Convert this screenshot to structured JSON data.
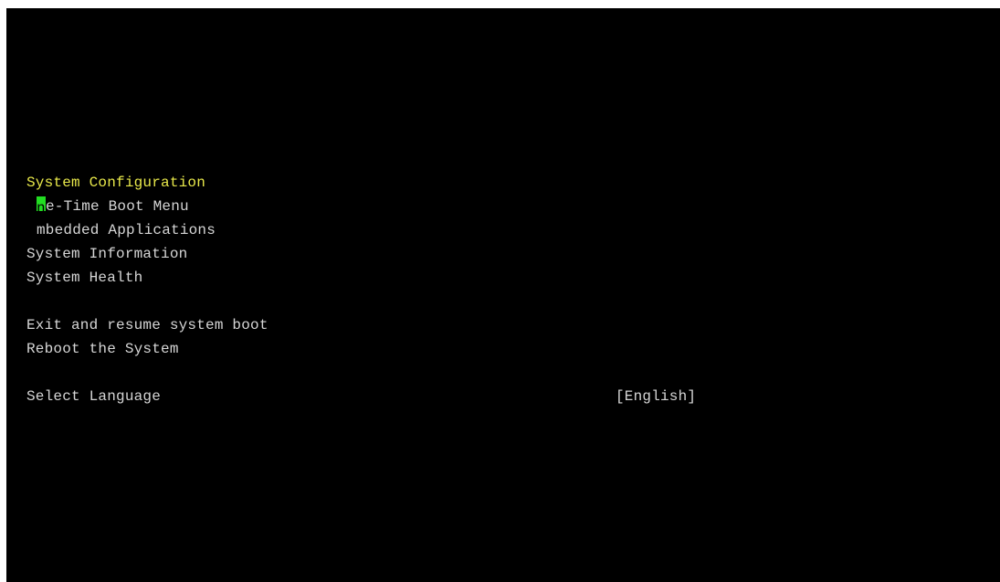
{
  "menu": {
    "title": "System Configuration",
    "items": [
      {
        "label": "e-Time Boot Menu"
      },
      {
        "label": "mbedded Applications"
      },
      {
        "label": "System Information"
      },
      {
        "label": "System Health"
      },
      {
        "label": "Exit and resume system boot"
      },
      {
        "label": "Reboot the System"
      }
    ],
    "cursor_char": "n",
    "language": {
      "label": "Select Language",
      "value": "[English]"
    }
  },
  "colors": {
    "background": "#000000",
    "text": "#d6d6d6",
    "title": "#e8e84a",
    "cursor": "#22dd22"
  }
}
